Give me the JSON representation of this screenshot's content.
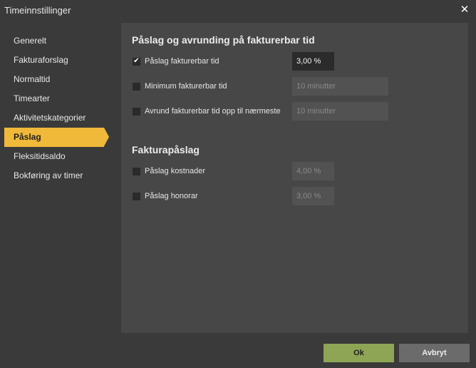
{
  "window": {
    "title": "Timeinnstillinger",
    "close_icon": "close-icon"
  },
  "sidebar": {
    "items": [
      {
        "label": "Generelt",
        "active": false
      },
      {
        "label": "Fakturaforslag",
        "active": false
      },
      {
        "label": "Normaltid",
        "active": false
      },
      {
        "label": "Timearter",
        "active": false
      },
      {
        "label": "Aktivitetskategorier",
        "active": false
      },
      {
        "label": "Påslag",
        "active": true
      },
      {
        "label": "Fleksitidsaldo",
        "active": false
      },
      {
        "label": "Bokføring av timer",
        "active": false
      }
    ]
  },
  "section1": {
    "title": "Påslag og avrunding på fakturerbar tid",
    "rows": [
      {
        "label": "Påslag fakturerbar tid",
        "checked": true,
        "value": "3,00 %"
      },
      {
        "label": "Minimum fakturerbar tid",
        "checked": false,
        "value": "10 minutter"
      },
      {
        "label": "Avrund fakturerbar tid opp til nærmeste",
        "checked": false,
        "value": "10 minutter"
      }
    ]
  },
  "section2": {
    "title": "Fakturapåslag",
    "rows": [
      {
        "label": "Påslag kostnader",
        "checked": false,
        "value": "4,00 %"
      },
      {
        "label": "Påslag honorar",
        "checked": false,
        "value": "3,00 %"
      }
    ]
  },
  "buttons": {
    "ok": "Ok",
    "cancel": "Avbryt"
  },
  "colors": {
    "accent": "#f0b93a",
    "ok_button": "#8da554",
    "background": "#3a3a3a",
    "panel": "#474747"
  }
}
